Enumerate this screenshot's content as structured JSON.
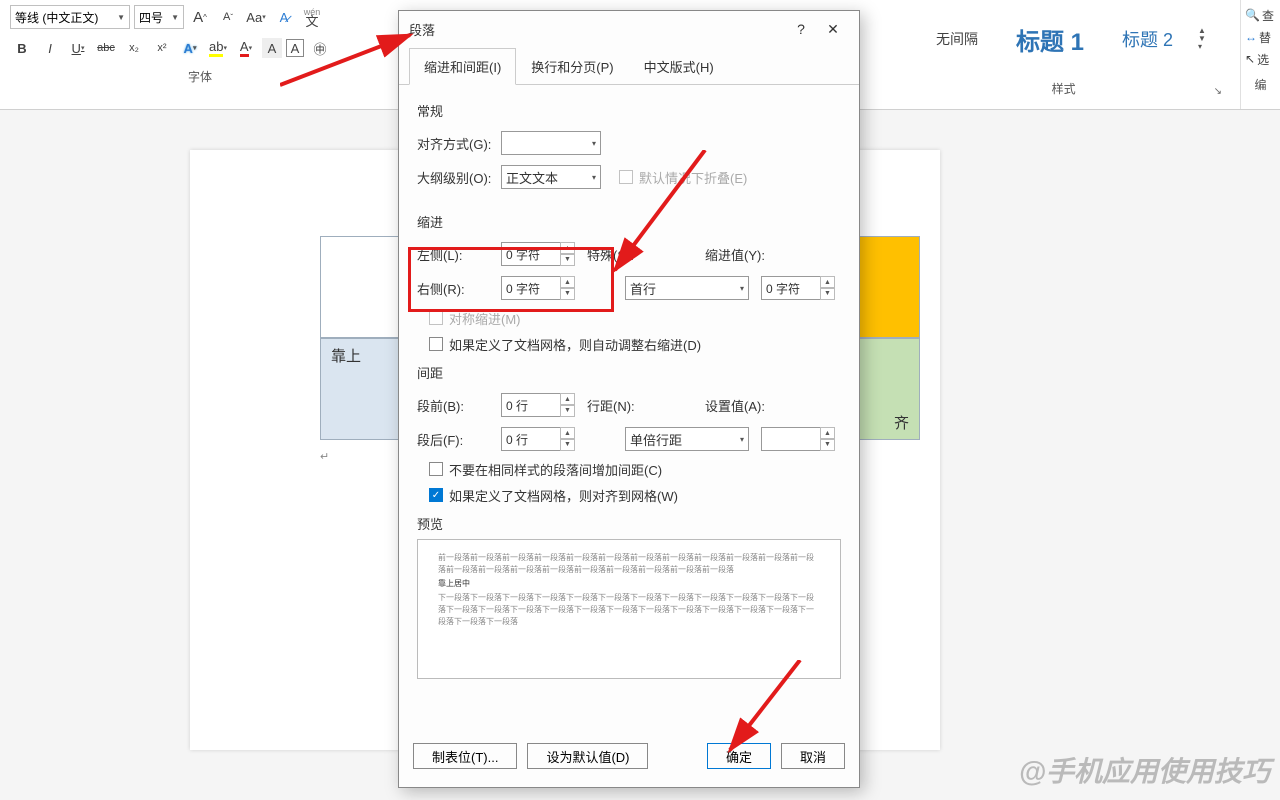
{
  "ribbon": {
    "font_name": "等线 (中文正文)",
    "font_size": "四号",
    "grow": "A",
    "shrink": "A",
    "case": "Aa",
    "clear": "A",
    "phonetic": "wén",
    "phonetic2": "文",
    "bold": "B",
    "italic": "I",
    "underline": "U",
    "strike": "abc",
    "sub": "x₂",
    "sup": "x²",
    "texteffect": "A",
    "highlight": "ab",
    "fontcolor": "A",
    "charshade": "A",
    "charborder": "A",
    "font_group": "字体",
    "style_nospace": "无间隔",
    "style_h1": "标题 1",
    "style_h2": "标题 2",
    "style_group": "样式",
    "find": "查",
    "replace": "替",
    "select": "选",
    "edit_group": "编"
  },
  "doc": {
    "cell_topleft": "靠上",
    "cell_botright": "齐"
  },
  "dialog": {
    "title": "段落",
    "help": "?",
    "close": "✕",
    "tabs": {
      "indent": "缩进和间距(I)",
      "page": "换行和分页(P)",
      "cjk": "中文版式(H)"
    },
    "general": "常规",
    "alignment_label": "对齐方式(G):",
    "outline_label": "大纲级别(O):",
    "outline_value": "正文文本",
    "collapse_label": "默认情况下折叠(E)",
    "indent": "缩进",
    "left_label": "左侧(L):",
    "left_value": "0 字符",
    "right_label": "右侧(R):",
    "right_value": "0 字符",
    "special_label": "特殊(S):",
    "special_value": "首行",
    "by_label": "缩进值(Y):",
    "by_value": "0 字符",
    "mirror": "对称缩进(M)",
    "autogrid": "如果定义了文档网格，则自动调整右缩进(D)",
    "spacing": "间距",
    "before_label": "段前(B):",
    "before_value": "0 行",
    "after_label": "段后(F):",
    "after_value": "0 行",
    "linespace_label": "行距(N):",
    "linespace_value": "单倍行距",
    "at_label": "设置值(A):",
    "nosame": "不要在相同样式的段落间增加间距(C)",
    "snapgrid": "如果定义了文档网格，则对齐到网格(W)",
    "preview": "预览",
    "preview_before": "前一段落前一段落前一段落前一段落前一段落前一段落前一段落前一段落前一段落前一段落前一段落前一段落前一段落前一段落前一段落前一段落前一段落前一段落前一段落前一段落前一段落",
    "preview_sample": "靠上居中",
    "preview_after": "下一段落下一段落下一段落下一段落下一段落下一段落下一段落下一段落下一段落下一段落下一段落下一段落下一段落下一段落下一段落下一段落下一段落下一段落下一段落下一段落下一段落下一段落下一段落下一段落下一段落下一段落",
    "tabs_btn": "制表位(T)...",
    "default_btn": "设为默认值(D)",
    "ok": "确定",
    "cancel": "取消"
  },
  "watermark": "@手机应用使用技巧"
}
